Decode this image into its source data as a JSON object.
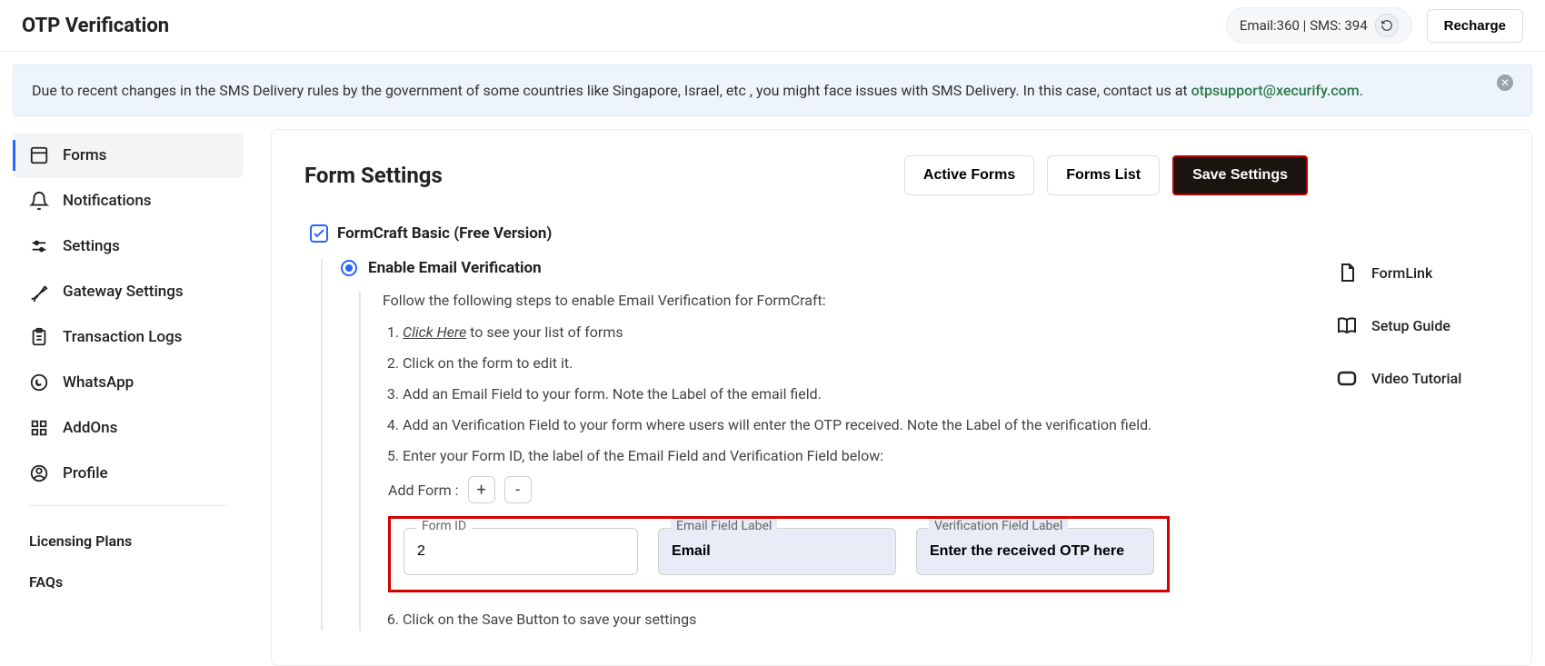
{
  "header": {
    "title": "OTP Verification",
    "credits_text": "Email:360 | SMS: 394",
    "recharge_label": "Recharge"
  },
  "banner": {
    "text_before": "Due to recent changes in the SMS Delivery rules by the government of some countries like Singapore, Israel, etc , you might face issues with SMS Delivery. In this case, contact us at ",
    "email": "otpsupport@xecurify.com",
    "text_after": "."
  },
  "sidebar": {
    "items": [
      {
        "label": "Forms"
      },
      {
        "label": "Notifications"
      },
      {
        "label": "Settings"
      },
      {
        "label": "Gateway Settings"
      },
      {
        "label": "Transaction Logs"
      },
      {
        "label": "WhatsApp"
      },
      {
        "label": "AddOns"
      },
      {
        "label": "Profile"
      }
    ],
    "licensing_label": "Licensing Plans",
    "faqs_label": "FAQs"
  },
  "main": {
    "title": "Form Settings",
    "buttons": {
      "active_forms": "Active Forms",
      "forms_list": "Forms List",
      "save_settings": "Save Settings"
    },
    "formcraft_label": "FormCraft Basic (Free Version)",
    "email_verif_label": "Enable Email Verification",
    "intro": "Follow the following steps to enable Email Verification for FormCraft:",
    "steps": {
      "s1a": "Click Here",
      "s1b": " to see your list of forms",
      "s2": "Click on the form to edit it.",
      "s3": "Add an Email Field to your form. Note the Label of the email field.",
      "s4": "Add an Verification Field to your form where users will enter the OTP received. Note the Label of the verification field.",
      "s5": "Enter your Form ID, the label of the Email Field and Verification Field below:",
      "s6": "Click on the Save Button to save your settings"
    },
    "add_form_label": "Add Form :",
    "plus": "+",
    "minus": "-",
    "fields": {
      "form_id_label": "Form ID",
      "form_id_value": "2",
      "email_label_label": "Email Field Label",
      "email_label_value": "Email",
      "verif_label_label": "Verification Field Label",
      "verif_label_value": "Enter the received OTP here"
    }
  },
  "right": {
    "formlink": "FormLink",
    "setup_guide": "Setup Guide",
    "video_tutorial": "Video Tutorial"
  }
}
